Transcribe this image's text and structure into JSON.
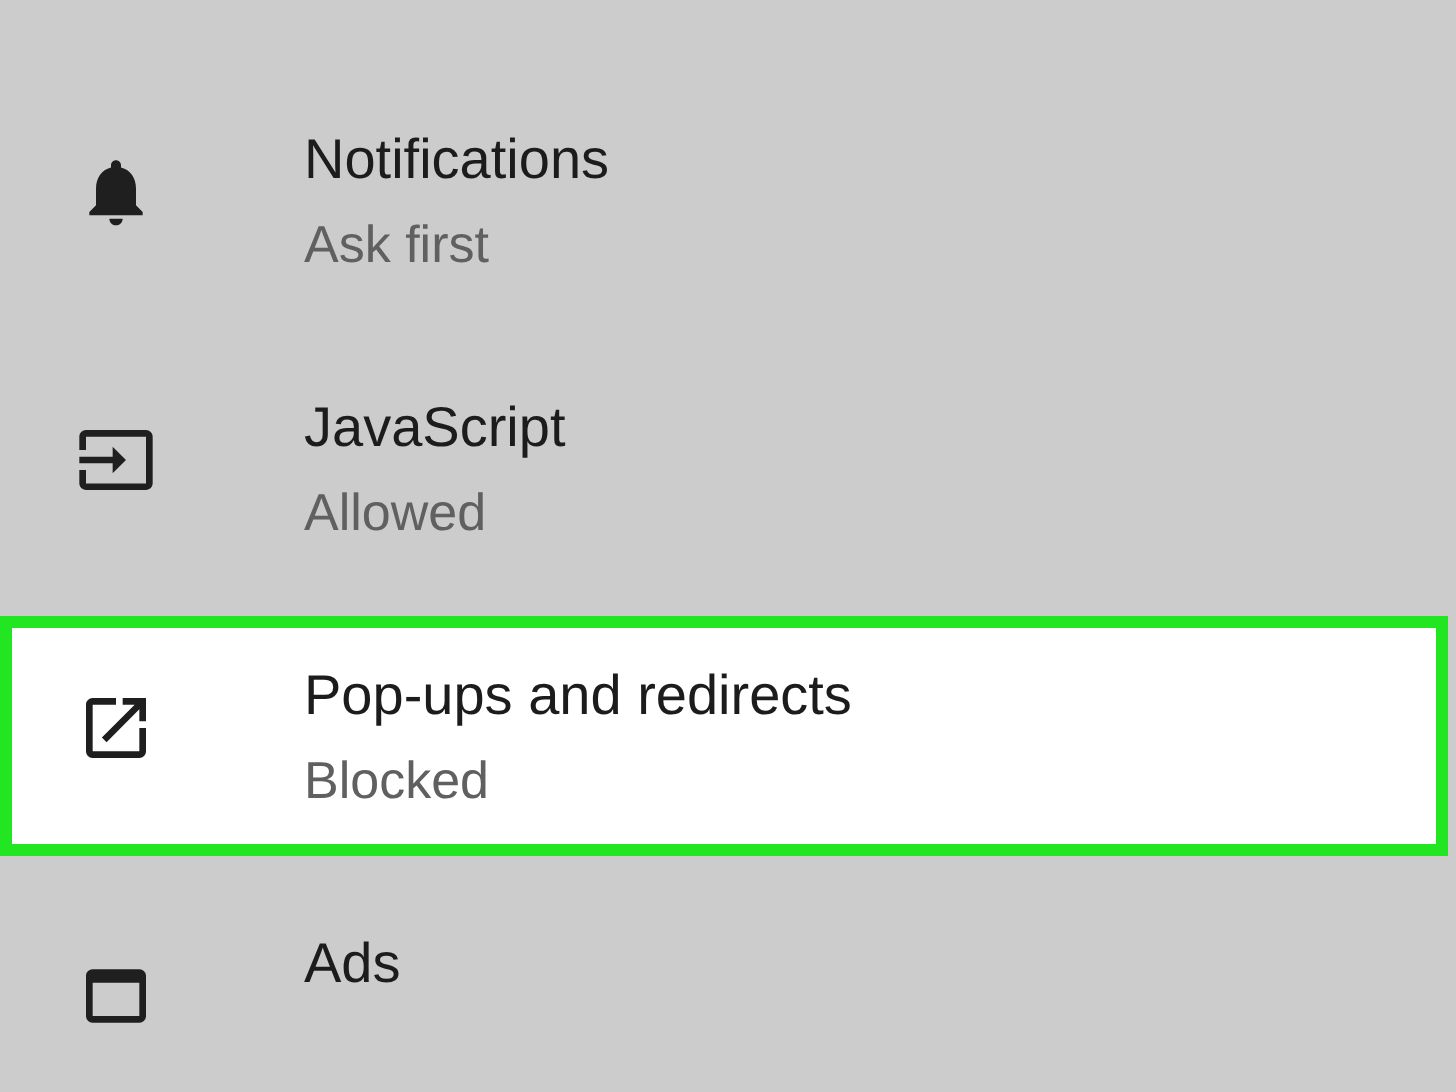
{
  "settings": [
    {
      "title": "Notifications",
      "subtitle": "Ask first",
      "highlighted": false
    },
    {
      "title": "JavaScript",
      "subtitle": "Allowed",
      "highlighted": false
    },
    {
      "title": "Pop-ups and redirects",
      "subtitle": "Blocked",
      "highlighted": true
    },
    {
      "title": "Ads",
      "highlighted": false
    }
  ]
}
